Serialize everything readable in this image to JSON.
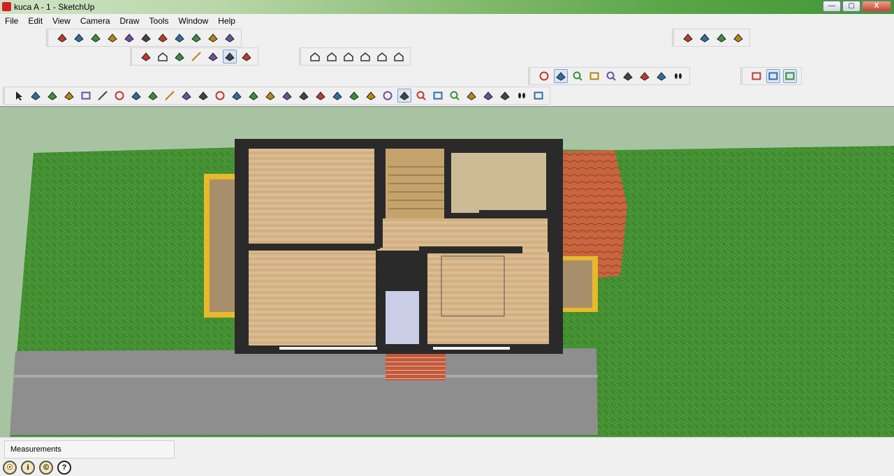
{
  "window": {
    "title": "kuca A - 1 - SketchUp",
    "controls": {
      "minimize": "—",
      "maximize": "▢",
      "close": "X"
    }
  },
  "menu": [
    "File",
    "Edit",
    "View",
    "Camera",
    "Draw",
    "Tools",
    "Window",
    "Help"
  ],
  "toolbars": {
    "standard": [
      "new-icon",
      "open-icon",
      "save-icon",
      "cut-icon",
      "copy-icon",
      "paste-icon",
      "erase-icon",
      "undo-icon",
      "redo-icon",
      "print-icon",
      "model-info-icon"
    ],
    "styles": [
      "xray-icon",
      "back-edges-icon",
      "wireframe-icon",
      "hidden-line-icon",
      "shaded-icon",
      "shaded-textures-icon",
      "monochrome-icon"
    ],
    "views": [
      "iso-icon",
      "top-icon",
      "front-icon",
      "right-icon",
      "back-icon",
      "left-icon"
    ],
    "warehouse": [
      "get-models-icon",
      "share-model-icon",
      "share-component-icon",
      "extension-icon"
    ],
    "camera_top": [
      "orbit-icon",
      "pan-icon",
      "zoom-icon",
      "zoom-window-icon",
      "zoom-extents-icon",
      "previous-icon",
      "position-camera-icon",
      "look-around-icon",
      "walk-icon"
    ],
    "sections": [
      "section-plane-icon",
      "display-section-planes-icon",
      "display-section-cuts-icon"
    ],
    "large_tools": [
      "select-icon",
      "make-component-icon",
      "paint-bucket-icon",
      "eraser-icon",
      "rectangle-icon",
      "line-icon",
      "circle-icon",
      "arc-icon",
      "polygon-icon",
      "freehand-icon",
      "move-icon",
      "push-pull-icon",
      "rotate-icon",
      "follow-me-icon",
      "scale-icon",
      "offset-icon",
      "tape-measure-icon",
      "dimension-icon",
      "protractor-icon",
      "text-icon",
      "axes-icon",
      "3d-text-icon",
      "orbit-icon",
      "pan-icon",
      "zoom-icon",
      "zoom-window-icon",
      "zoom-extents-icon",
      "previous-icon",
      "position-camera-icon",
      "look-around-icon",
      "walk-icon",
      "section-plane-icon"
    ]
  },
  "status": {
    "measurements_label": "Measurements",
    "help_glyph": "?"
  },
  "colors": {
    "grass": "#3f8a2e",
    "sky": "#a8c3a2",
    "wall": "#2a2a2a",
    "floor": "#d2b48c",
    "road": "#8c8c8c",
    "roof": "#c0603e"
  }
}
